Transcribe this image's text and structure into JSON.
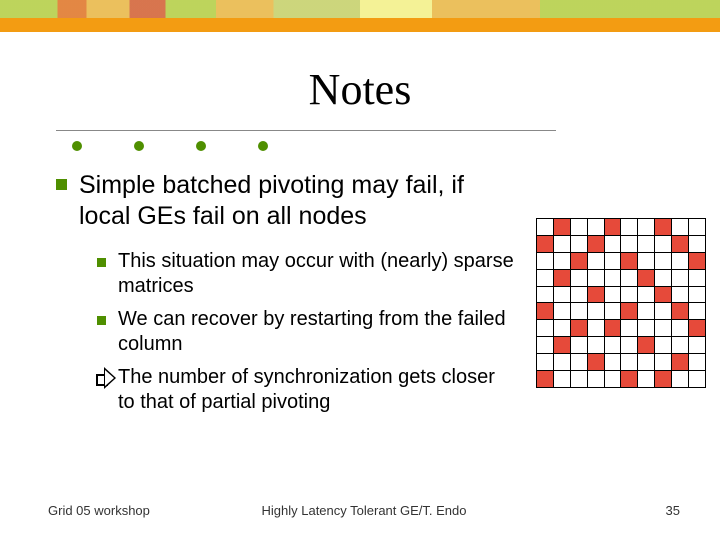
{
  "title": "Notes",
  "main_bullet": "Simple batched pivoting may fail, if local GEs fail on all nodes",
  "sub_bullets": [
    "This situation may occur with (nearly) sparse matrices",
    "We can recover by restarting from the failed column",
    "The number of synchronization gets closer to that of partial pivoting"
  ],
  "footer": {
    "left": "Grid 05 workshop",
    "center": "Highly Latency Tolerant GE/T. Endo",
    "right": "35"
  },
  "matrix": {
    "size": 10,
    "filled": [
      [
        0,
        1
      ],
      [
        0,
        4
      ],
      [
        0,
        7
      ],
      [
        1,
        0
      ],
      [
        1,
        3
      ],
      [
        1,
        8
      ],
      [
        2,
        2
      ],
      [
        2,
        5
      ],
      [
        2,
        9
      ],
      [
        3,
        1
      ],
      [
        3,
        6
      ],
      [
        4,
        3
      ],
      [
        4,
        7
      ],
      [
        5,
        0
      ],
      [
        5,
        5
      ],
      [
        5,
        8
      ],
      [
        6,
        2
      ],
      [
        6,
        4
      ],
      [
        6,
        9
      ],
      [
        7,
        1
      ],
      [
        7,
        6
      ],
      [
        8,
        3
      ],
      [
        8,
        8
      ],
      [
        9,
        0
      ],
      [
        9,
        5
      ],
      [
        9,
        7
      ]
    ]
  }
}
